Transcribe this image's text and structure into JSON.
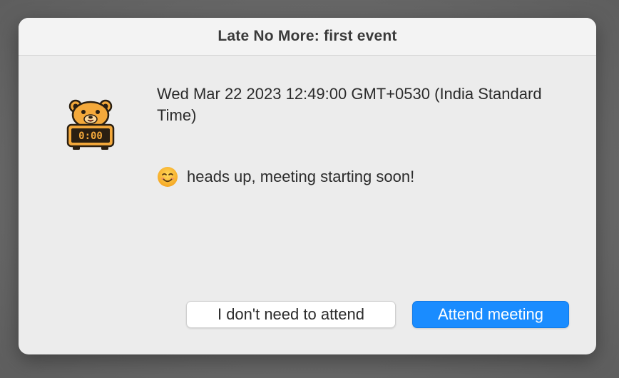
{
  "dialog": {
    "title": "Late No More: first event",
    "datetime_text": "Wed Mar 22 2023 12:49:00 GMT+0530 (India Standard Time)",
    "message_text": "heads up, meeting starting soon!",
    "icons": {
      "app_icon": "bear-clock-icon",
      "emoji": "smiling-face-emoji-icon"
    },
    "buttons": {
      "decline_label": "I don't need to attend",
      "attend_label": "Attend meeting"
    },
    "colors": {
      "accent": "#1a8cff",
      "bear": "#f4a93b",
      "clock_display": "#2a1f12"
    }
  }
}
